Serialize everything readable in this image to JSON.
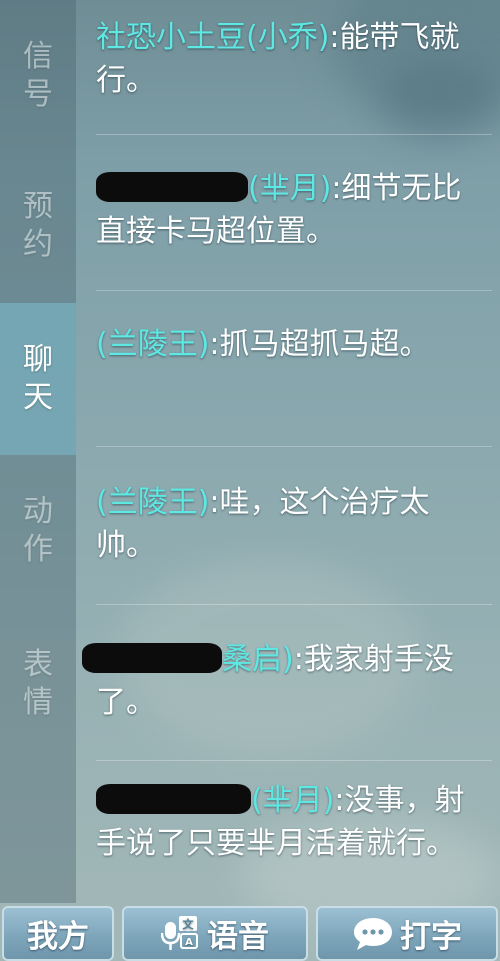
{
  "sidebar": {
    "tabs": [
      {
        "label": "信号",
        "active": false
      },
      {
        "label": "预约",
        "active": false
      },
      {
        "label": "聊天",
        "active": true
      },
      {
        "label": "动作",
        "active": false
      },
      {
        "label": "表情",
        "active": false
      }
    ]
  },
  "chat": {
    "messages": [
      {
        "name": "社恐小土豆(小乔)",
        "text": ":能带飞就行。",
        "name_redacted": false
      },
      {
        "name": "(芈月)",
        "text": ":细节无比直接卡马超位置。",
        "name_redacted": true
      },
      {
        "name": "(兰陵王)",
        "text": ":抓马超抓马超。",
        "name_redacted": false
      },
      {
        "name": "(兰陵王)",
        "text": ":哇，这个治疗太帅。",
        "name_redacted": false
      },
      {
        "name": "桑启)",
        "text": ":我家射手没了。",
        "name_redacted": true
      },
      {
        "name": "(芈月)",
        "text": ":没事，射手说了只要芈月活着就行。",
        "name_redacted": true
      }
    ]
  },
  "bottom": {
    "side_label": "我方",
    "voice_label": "语音",
    "type_label": "打字",
    "voice_icon": "microphone-translate-icon",
    "type_icon": "speech-bubble-icon"
  },
  "colors": {
    "name": "#5ee8e3",
    "text": "#ffffff",
    "active_tab": "#78afbe"
  }
}
